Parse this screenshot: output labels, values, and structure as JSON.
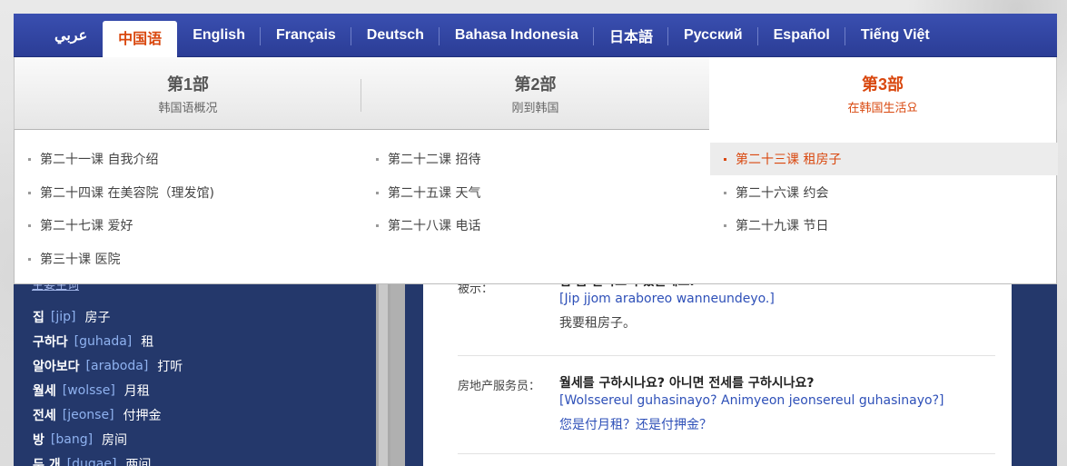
{
  "languages": [
    "عربي",
    "中国语",
    "English",
    "Français",
    "Deutsch",
    "Bahasa Indonesia",
    "日本語",
    "Русский",
    "Español",
    "Tiếng Việt"
  ],
  "active_language": "中国语",
  "parts": [
    {
      "num": "第1部",
      "sub": "韩国语概况"
    },
    {
      "num": "第2部",
      "sub": "刚到韩国"
    },
    {
      "num": "第3部",
      "sub": "在韩国生活요"
    }
  ],
  "active_part": "第3部",
  "lessons": [
    "第二十一课 自我介绍",
    "第二十二课 招待",
    "第二十三课 租房子",
    "第二十四课 在美容院（理发馆)",
    "第二十五课 天气",
    "第二十六课 约会",
    "第二十七课 爱好",
    "第二十八课 电话",
    "第二十九课 节日",
    "第三十课 医院"
  ],
  "active_lesson": "第二十三课 租房子",
  "vocab": {
    "title": "主要生词",
    "items": [
      {
        "kr": "집",
        "ro": "[jip]",
        "cn": "房子"
      },
      {
        "kr": "구하다",
        "ro": "[guhada]",
        "cn": "租"
      },
      {
        "kr": "알아보다",
        "ro": "[araboda]",
        "cn": "打听"
      },
      {
        "kr": "월세",
        "ro": "[wolsse]",
        "cn": "月租"
      },
      {
        "kr": "전세",
        "ro": "[jeonse]",
        "cn": "付押金"
      },
      {
        "kr": "방",
        "ro": "[bang]",
        "cn": "房间"
      },
      {
        "kr": "두 개",
        "ro": "[dugae]",
        "cn": "两间"
      }
    ]
  },
  "dialogue": [
    {
      "speaker": "被示：",
      "kr": "집 좀 알아보러 왔는데요.",
      "ro": "[Jip jjom araboreo wanneundeyo.]",
      "cn": "我要租房子。"
    },
    {
      "speaker": "房地产服务员：",
      "kr": "월세를 구하시나요? 아니면 전세를 구하시나요?",
      "ro": "[Wolssereul guhasinayo? Animyeon jeonsereul guhasinayo?]",
      "cn": "您是付月租？还是付押金？"
    }
  ],
  "colors": {
    "nav_blue": "#2b3d96",
    "accent": "#d9480f",
    "panel_navy": "#24386b",
    "romanization_blue": "#2e50b8"
  }
}
